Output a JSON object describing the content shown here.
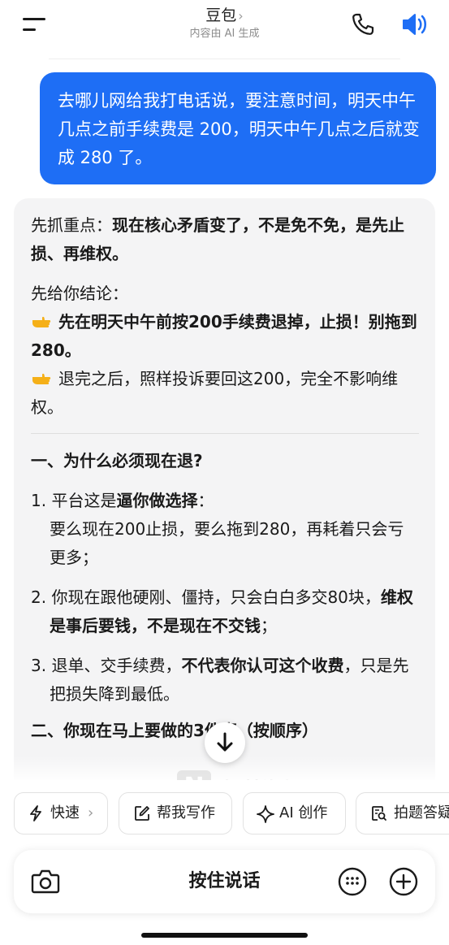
{
  "header": {
    "title": "豆包",
    "title_chevron": "›",
    "subtitle": "内容由 AI 生成"
  },
  "user_message": "去哪儿网给我打电话说，要注意时间，明天中午几点之前手续费是 200，明天中午几点之后就变成 280 了。",
  "ai_reply": {
    "p1_prefix": "先抓重点：",
    "p1_bold": "现在核心矛盾变了，不是免不免，是先止损、再维权。",
    "conclusion_label": "先给你结论：",
    "conclusion_1": "先在明天中午前按200手续费退掉，止损！别拖到280。",
    "conclusion_2": "退完之后，照样投诉要回这200，完全不影响维权。",
    "section1_title": "一、为什么必须现在退?",
    "item1_a": "1. 平台这是",
    "item1_b": "逼你做选择",
    "item1_c": "：",
    "item1_line2": "要么现在200止损，要么拖到280，再耗着只会亏更多；",
    "item2_a": "2. 你现在跟他硬刚、僵持，只会白白多交80块，",
    "item2_b": "维权是事后要钱，不是现在不交钱",
    "item2_c": "；",
    "item3_a": "3. 退单、交手续费，",
    "item3_b": "不代表你认可这个收费",
    "item3_c": "，只是先把损失降到最低。",
    "section2_title": "二、你现在马上要做的3件事（按顺序）"
  },
  "watermark": "智慧海都APP",
  "chips": [
    {
      "label": "快速",
      "suffix": "›",
      "icon": "lightning-icon"
    },
    {
      "label": "帮我写作",
      "icon": "edit-icon"
    },
    {
      "label": "AI 创作",
      "icon": "sparkle-icon"
    },
    {
      "label": "拍题答疑",
      "icon": "search-doc-icon"
    }
  ],
  "input": {
    "hold_to_talk": "按住说话"
  },
  "colors": {
    "accent": "#1e6ef5",
    "card_bg": "#f4f4f5",
    "point_emoji": "#f5b018"
  }
}
